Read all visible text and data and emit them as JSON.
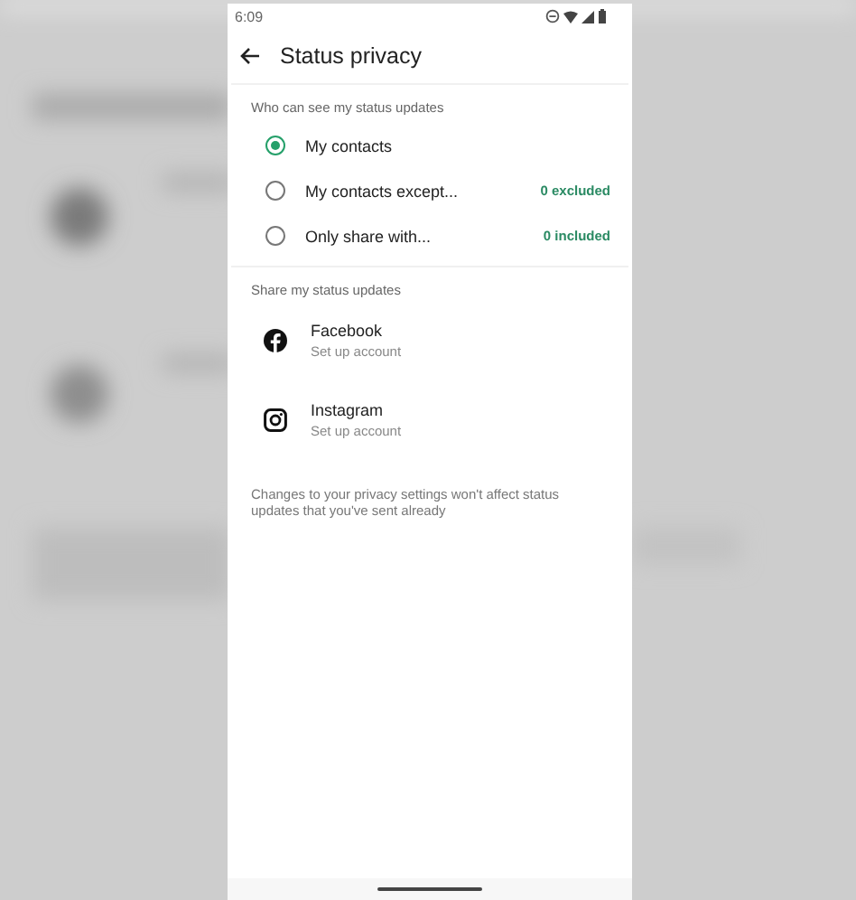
{
  "status_bar": {
    "time": "6:09"
  },
  "header": {
    "title": "Status privacy"
  },
  "visibility": {
    "heading": "Who can see my status updates",
    "options": [
      {
        "label": "My contacts",
        "selected": true
      },
      {
        "label": "My contacts except...",
        "count": "0 excluded",
        "selected": false
      },
      {
        "label": "Only share with...",
        "count": "0 included",
        "selected": false
      }
    ]
  },
  "share": {
    "heading": "Share my status updates",
    "accounts": [
      {
        "kind": "facebook",
        "name": "Facebook",
        "subtitle": "Set up account"
      },
      {
        "kind": "instagram",
        "name": "Instagram",
        "subtitle": "Set up account"
      }
    ]
  },
  "note": "Changes to your privacy settings won't affect status updates that you've sent already"
}
